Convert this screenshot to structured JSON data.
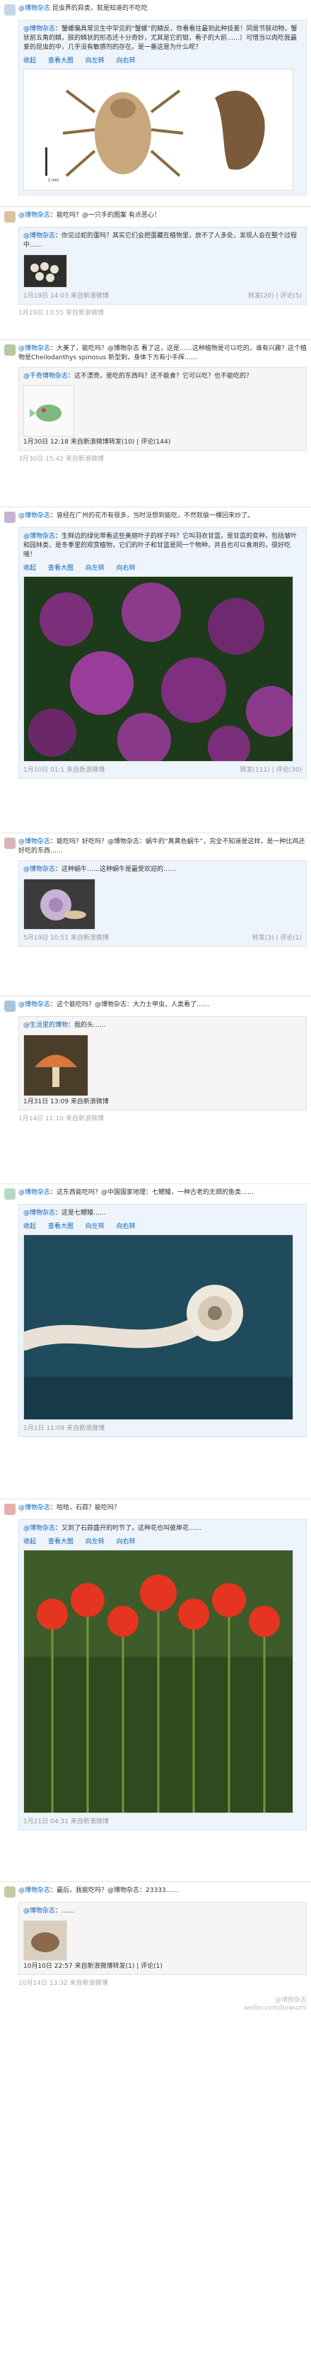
{
  "posts": [
    {
      "id": "p1",
      "head_user": "@博物杂志",
      "head_text": "昆虫界的异类，就是知道的不吃吃",
      "card_user": "@博物杂志",
      "card_text": "：蟹螺偏具常见生中罕见的“蟹螺”的鳞反，你看看往最到此种技差！同是节肢动物，蟹状前五角的鳞，肢的鳞状的形态还十分奇妙，尤其是它的钳，看子的大前……）可惜当以肉吃我最爱的昆虫的中，几乎没有敏感剂的存在。是一番这是为什么呢？",
      "tools": [
        "收起",
        "查看大图",
        "向左转",
        "向右转"
      ],
      "caption": "1 mm"
    },
    {
      "id": "p2",
      "head_user": "@博物杂志",
      "head_link": "@一只手的图案",
      "head_text": "：能吃吗？@一只手的图案 有点恶心！",
      "card_user": "@博物杂志",
      "card_text": "：你见过蛇的蛋吗？其实它们会把蛋藏在植物里，放不了人多处，发现人会在整个过程中……",
      "date": "1月19日 14:03",
      "source": "来自新浪微博",
      "actions": "转发(20) | 评论(5)",
      "meta": "1月19日 13:55  来自新浪微博"
    },
    {
      "id": "p3",
      "head_user": "@博物杂志",
      "head_text": "：大美了，能吃吗？@博物杂志 看了这，这是……这种植物是可以吃的，谁有兴趣？这个植物是Cheilodanthys spinosus 新型刺，身体下方有小手挥……",
      "comment_user": "@千奇博物杂志",
      "comment_text": "：这不漂亮，是吃的东西吗？还不能食？它可以吃？也不能吃的？",
      "comment_meta": "1月30日 12:18  来自新浪微博",
      "comment_actions": "转发(10) | 评论(144)",
      "meta": "3月30日 15:42  来自新浪微博"
    },
    {
      "id": "p4",
      "head_user": "@博物杂志",
      "head_text": "：曾经在广州的花市有很多，当时没想到能吃，不然就偷一棵回来炒了。",
      "card_user": "@博物杂志",
      "card_text": "：生鲜边的绿化带看这些美丽叶子的样子吗？它叫羽衣甘蓝，是甘蓝的变种，包括皱叶和园林类，是冬季里的观赏植物，它们的叶子和甘蓝是同一个物种，并且也可以食用的，很好吃哦！",
      "tools": [
        "收起",
        "查看大图",
        "向左转",
        "向右转"
      ],
      "meta": "1月10日 01:1  来自新浪微博",
      "actions": "转发(111) | 评论(30)"
    },
    {
      "id": "p5",
      "head_user": "@博物杂志",
      "head_text": "：能吃吗？好吃吗？@博物杂志：蜗牛的“真黄色蜗牛”，完全不知道是这样，是一种比鸡还好吃的东西……",
      "card_user": "@博物杂志",
      "card_text": "：这种蜗牛……这种蜗牛是最受欢迎的……",
      "meta": "5月19日 10:51  来自新浪微博",
      "actions": "转发(3) | 评论(1)"
    },
    {
      "id": "p6",
      "head_user": "@博物杂志",
      "head_text": "：这个能吃吗？@博物杂志：大力士甲虫，人类看了……",
      "comment_user": "@生活里的博物",
      "comment_text": "：我的头……",
      "comment_meta": "1月31日 13:09  来自新浪微博",
      "meta": "1月14日 11:10  来自新浪微博"
    },
    {
      "id": "p7",
      "head_user": "@博物杂志",
      "head_text": "：这东西能吃吗？@中国国家地理：七鳃鳗，一种古老的无颌的鱼类……",
      "card_user": "@博物杂志",
      "card_text": "：这是七鳃鳗……",
      "tools": [
        "收起",
        "查看大图",
        "向左转",
        "向右转"
      ],
      "meta": "1月1日 11:09  来自新浪微博"
    },
    {
      "id": "p8",
      "head_user": "@博物杂志",
      "head_text": "：哈哈，石蒜？能吃吗？",
      "card_user": "@博物杂志",
      "card_text": "：又到了石蒜盛开的时节了，这种花也叫彼岸花……",
      "tools": [
        "收起",
        "查看大图",
        "向左转",
        "向右转"
      ],
      "meta": "1月21日 04:31  来自新浪微博"
    },
    {
      "id": "p9",
      "head_user": "@博物杂志",
      "head_text": "：最后，我能吃吗？@博物杂志：23333……",
      "comment_user": "@博物杂志",
      "comment_text": "：……",
      "comment_meta": "10月10日 22:57  来自新浪微博",
      "comment_actions": "转发(1) | 评论(1)"
    }
  ],
  "footer": {
    "date": "10月14日 13:32",
    "source": "来自新浪微博",
    "watermark_line1": "@博物杂志",
    "watermark_line2": "weibo.com/bowuzhi"
  }
}
